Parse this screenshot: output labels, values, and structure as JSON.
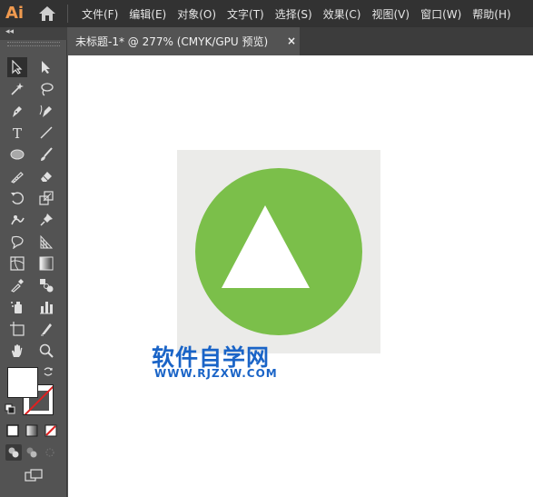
{
  "app": {
    "logo": "Ai"
  },
  "menubar": {
    "items": [
      "文件(F)",
      "编辑(E)",
      "对象(O)",
      "文字(T)",
      "选择(S)",
      "效果(C)",
      "视图(V)",
      "窗口(W)",
      "帮助(H)"
    ]
  },
  "document_tab": {
    "title": "未标题-1* @ 277% (CMYK/GPU 预览)",
    "close": "×"
  },
  "toolbar": {
    "collapse": "◂◂",
    "tools": [
      "selection-tool",
      "direct-selection-tool",
      "magic-wand-tool",
      "lasso-tool",
      "pen-tool",
      "curvature-tool",
      "type-tool",
      "line-segment-tool",
      "ellipse-tool",
      "paintbrush-tool",
      "shaper-tool",
      "eraser-tool",
      "rotate-tool",
      "scale-tool",
      "puppet-warp-tool",
      "pin-tool",
      "free-transform-tool",
      "perspective-grid-tool",
      "mesh-tool",
      "gradient-tool",
      "eyedropper-tool",
      "blend-tool",
      "symbol-sprayer-tool",
      "column-graph-tool",
      "artboard-tool",
      "slice-tool",
      "hand-tool",
      "zoom-tool"
    ]
  },
  "colors": {
    "circle": "#7bbf4a",
    "triangle": "#ffffff",
    "artboard_bg": "#ebebe9",
    "watermark": "#1a64c7"
  },
  "watermark": {
    "title": "软件自学网",
    "url": "WWW.RJZXW.COM"
  }
}
